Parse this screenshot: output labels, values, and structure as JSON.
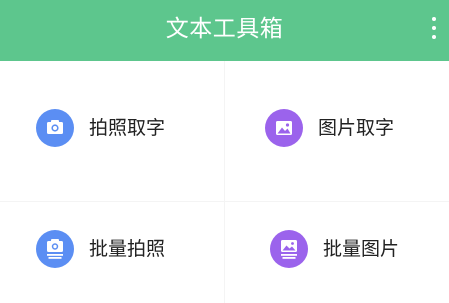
{
  "app_bar": {
    "title": "文本工具箱",
    "background": "#5dc68d",
    "overflow_icon": "more-vertical-icon"
  },
  "tools": [
    {
      "label": "拍照取字",
      "icon": "camera-icon",
      "color": "#5b8ef3"
    },
    {
      "label": "图片取字",
      "icon": "image-icon",
      "color": "#9b63ec"
    },
    {
      "label": "批量拍照",
      "icon": "camera-stack-icon",
      "color": "#5b8ef3"
    },
    {
      "label": "批量图片",
      "icon": "image-stack-icon",
      "color": "#9b63ec"
    }
  ]
}
